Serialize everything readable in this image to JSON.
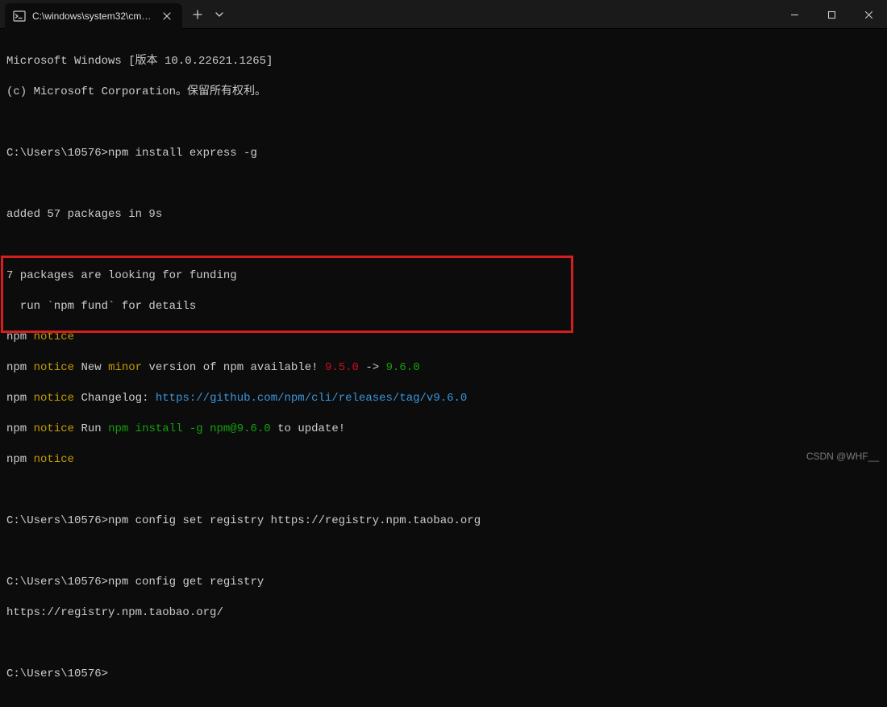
{
  "titlebar": {
    "tab_title": "C:\\windows\\system32\\cmd.exe"
  },
  "term": {
    "line1": "Microsoft Windows [版本 10.0.22621.1265]",
    "line2": "(c) Microsoft Corporation。保留所有权利。",
    "prompt1_pre": "C:\\Users\\10576>",
    "prompt1_cmd": "npm install express -g",
    "added": "added 57 packages in 9s",
    "funding1": "7 packages are looking for funding",
    "funding2": "  run `npm fund` for details",
    "npm": "npm",
    "notice": "notice",
    "new_word": "New",
    "minor_word": "minor",
    "version_rest": "version of npm available!",
    "arrow": "->",
    "old_ver": "9.5.0",
    "new_ver": "9.6.0",
    "changelog_label": "Changelog:",
    "changelog_url": "https://github.com/npm/cli/releases/tag/v9.6.0",
    "run_word": "Run",
    "run_cmd": "npm install -g npm@9.6.0",
    "run_tail": "to update!",
    "prompt2_pre": "C:\\Users\\10576>",
    "prompt2_cmd": "npm config set registry https://registry.npm.taobao.org",
    "prompt3_pre": "C:\\Users\\10576>",
    "prompt3_cmd": "npm config get registry",
    "registry_out": "https://registry.npm.taobao.org/",
    "prompt4_pre": "C:\\Users\\10576>"
  },
  "watermark": "CSDN @WHF__"
}
